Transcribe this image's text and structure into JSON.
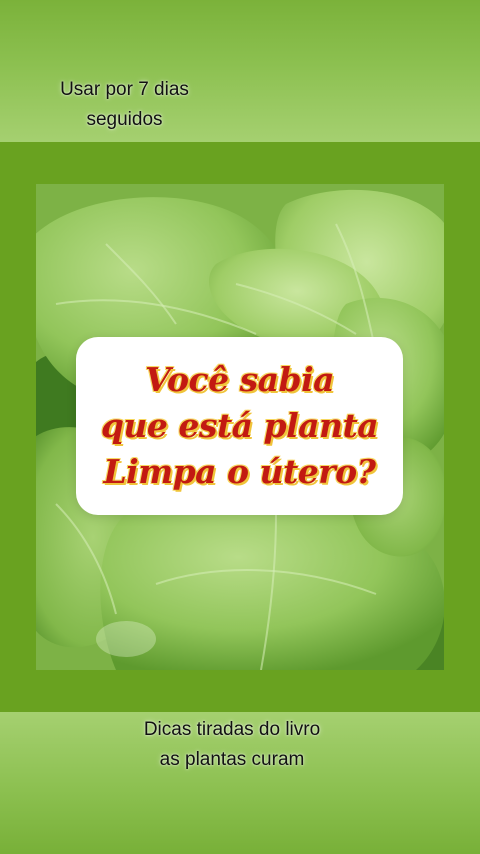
{
  "top_caption": {
    "line1": "Usar por 7 dias",
    "line2": "seguidos"
  },
  "bottom_caption": {
    "line1": "Dicas tiradas do livro",
    "line2": "as plantas curam"
  },
  "card": {
    "line1": "Você sabia",
    "line2": "que está planta",
    "line3": "Limpa o útero?"
  },
  "photo": {
    "subject": "plant-leaves-image"
  },
  "colors": {
    "background_green": "#69a220",
    "card_text_red": "#c21a12",
    "card_text_outline_yellow": "#f0c43a",
    "card_background": "#ffffff"
  }
}
